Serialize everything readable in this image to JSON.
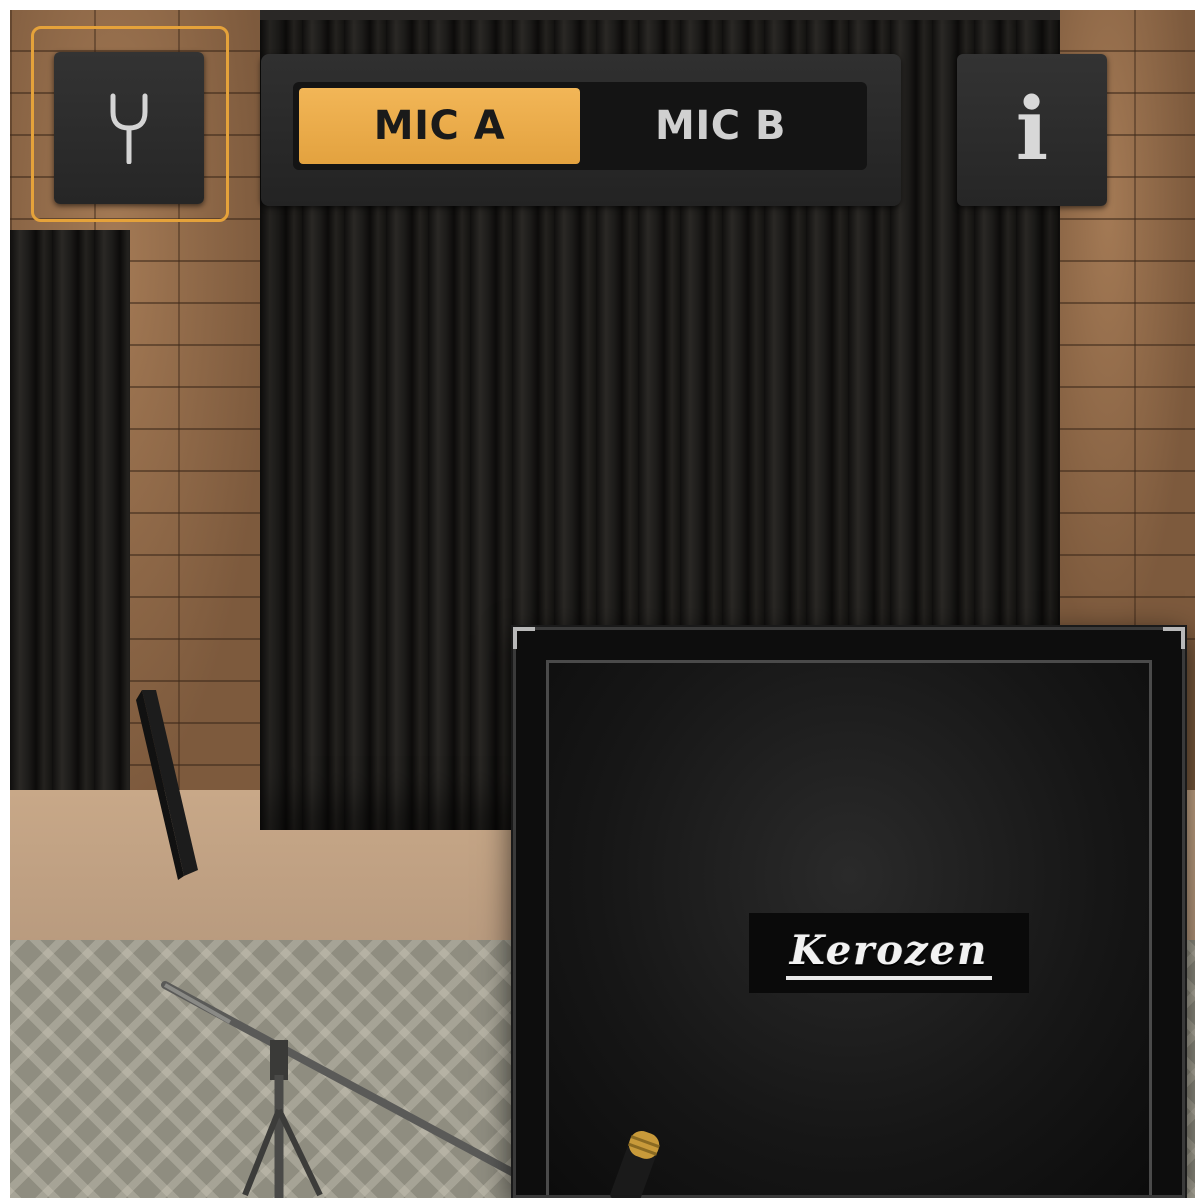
{
  "toolbar": {
    "splitter_icon": "tuning-fork-icon",
    "info_icon": "info-icon",
    "info_glyph": "i",
    "focus_color": "#e5a23a"
  },
  "mic_selector": {
    "tabs": [
      {
        "label": "MIC A",
        "selected": true
      },
      {
        "label": "MIC B",
        "selected": false
      }
    ],
    "accent_color": "#e8a843"
  },
  "cabinet": {
    "brand": "Kerozen"
  }
}
